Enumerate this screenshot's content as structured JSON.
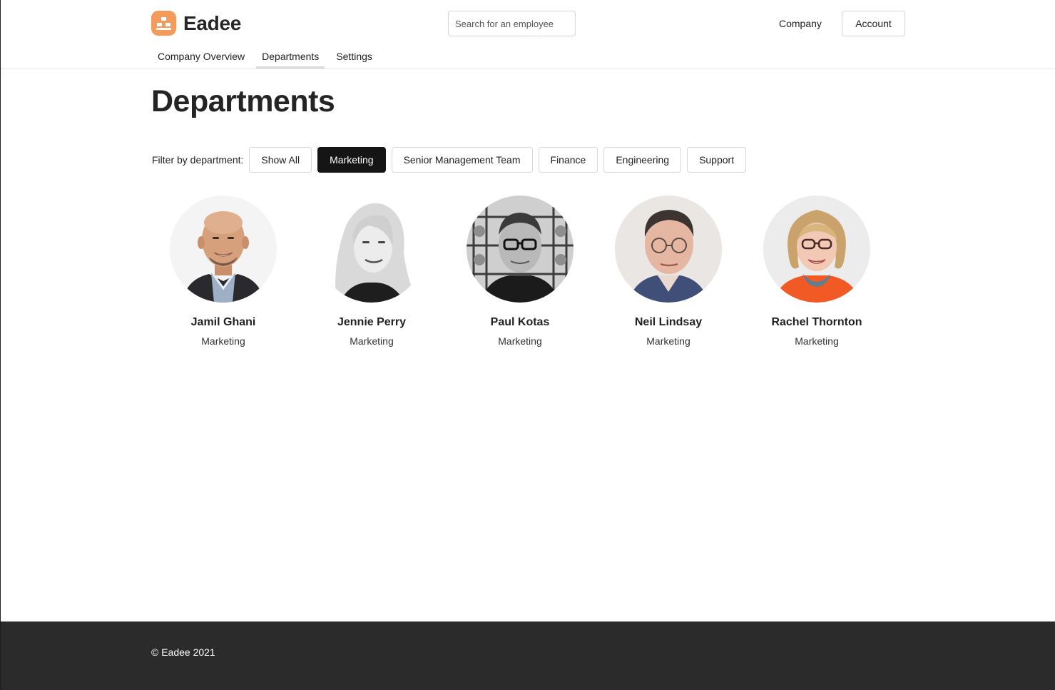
{
  "brand": {
    "name": "Eadee",
    "logo_color": "#f29b5c"
  },
  "search": {
    "placeholder": "Search for an employee"
  },
  "top_nav": {
    "company": "Company",
    "account": "Account"
  },
  "tabs": [
    {
      "label": "Company Overview",
      "active": false
    },
    {
      "label": "Departments",
      "active": true
    },
    {
      "label": "Settings",
      "active": false
    }
  ],
  "page": {
    "title": "Departments"
  },
  "filter": {
    "label": "Filter by department:",
    "options": [
      "Show All",
      "Marketing",
      "Senior Management Team",
      "Finance",
      "Engineering",
      "Support"
    ],
    "selected": "Marketing"
  },
  "employees": [
    {
      "name": "Jamil Ghani",
      "department": "Marketing",
      "photo": "smiling man with shaved head, checked shirt"
    },
    {
      "name": "Jennie Perry",
      "department": "Marketing",
      "photo": "black and white portrait of woman with long blonde hair"
    },
    {
      "name": "Paul Kotas",
      "department": "Marketing",
      "photo": "black and white portrait of man with glasses"
    },
    {
      "name": "Neil Lindsay",
      "department": "Marketing",
      "photo": "man with glasses, light background"
    },
    {
      "name": "Rachel Thornton",
      "department": "Marketing",
      "photo": "woman with glasses, orange top, scarf"
    }
  ],
  "footer": {
    "copyright": "© Eadee 2021"
  },
  "colors": {
    "active_filter_bg": "#151515",
    "footer_bg": "#2b2b2b",
    "accent": "#f29b5c"
  }
}
